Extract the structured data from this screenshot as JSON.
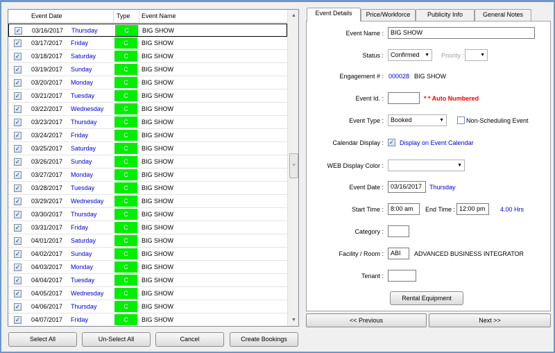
{
  "grid": {
    "headers": {
      "event_date": "Event Date",
      "type": "Type",
      "event_name": "Event Name"
    },
    "rows": [
      {
        "date": "03/16/2017",
        "day": "Thursday",
        "type": "C",
        "name": "BIG SHOW",
        "checked": true
      },
      {
        "date": "03/17/2017",
        "day": "Friday",
        "type": "C",
        "name": "BIG SHOW",
        "checked": true
      },
      {
        "date": "03/18/2017",
        "day": "Saturday",
        "type": "C",
        "name": "BIG SHOW",
        "checked": true
      },
      {
        "date": "03/19/2017",
        "day": "Sunday",
        "type": "C",
        "name": "BIG SHOW",
        "checked": true
      },
      {
        "date": "03/20/2017",
        "day": "Monday",
        "type": "C",
        "name": "BIG SHOW",
        "checked": true
      },
      {
        "date": "03/21/2017",
        "day": "Tuesday",
        "type": "C",
        "name": "BIG SHOW",
        "checked": true
      },
      {
        "date": "03/22/2017",
        "day": "Wednesday",
        "type": "C",
        "name": "BIG SHOW",
        "checked": true
      },
      {
        "date": "03/23/2017",
        "day": "Thursday",
        "type": "C",
        "name": "BIG SHOW",
        "checked": true
      },
      {
        "date": "03/24/2017",
        "day": "Friday",
        "type": "C",
        "name": "BIG SHOW",
        "checked": true
      },
      {
        "date": "03/25/2017",
        "day": "Saturday",
        "type": "C",
        "name": "BIG SHOW",
        "checked": true
      },
      {
        "date": "03/26/2017",
        "day": "Sunday",
        "type": "C",
        "name": "BIG SHOW",
        "checked": true
      },
      {
        "date": "03/27/2017",
        "day": "Monday",
        "type": "C",
        "name": "BIG SHOW",
        "checked": true
      },
      {
        "date": "03/28/2017",
        "day": "Tuesday",
        "type": "C",
        "name": "BIG SHOW",
        "checked": true
      },
      {
        "date": "03/29/2017",
        "day": "Wednesday",
        "type": "C",
        "name": "BIG SHOW",
        "checked": true
      },
      {
        "date": "03/30/2017",
        "day": "Thursday",
        "type": "C",
        "name": "BIG SHOW",
        "checked": true
      },
      {
        "date": "03/31/2017",
        "day": "Friday",
        "type": "C",
        "name": "BIG SHOW",
        "checked": true
      },
      {
        "date": "04/01/2017",
        "day": "Saturday",
        "type": "C",
        "name": "BIG SHOW",
        "checked": true
      },
      {
        "date": "04/02/2017",
        "day": "Sunday",
        "type": "C",
        "name": "BIG SHOW",
        "checked": true
      },
      {
        "date": "04/03/2017",
        "day": "Monday",
        "type": "C",
        "name": "BIG SHOW",
        "checked": true
      },
      {
        "date": "04/04/2017",
        "day": "Tuesday",
        "type": "C",
        "name": "BIG SHOW",
        "checked": true
      },
      {
        "date": "04/05/2017",
        "day": "Wednesday",
        "type": "C",
        "name": "BIG SHOW",
        "checked": true
      },
      {
        "date": "04/06/2017",
        "day": "Thursday",
        "type": "C",
        "name": "BIG SHOW",
        "checked": true
      },
      {
        "date": "04/07/2017",
        "day": "Friday",
        "type": "C",
        "name": "BIG SHOW",
        "checked": true
      }
    ]
  },
  "buttons": {
    "select_all": "Select All",
    "unselect_all": "Un-Select All",
    "cancel": "Cancel",
    "create_bookings": "Create Bookings"
  },
  "tabs": [
    "Event Details",
    "Price/Workforce",
    "Publicity Info",
    "General Notes"
  ],
  "details": {
    "event_name_label": "Event Name :",
    "event_name_value": "BIG SHOW",
    "status_label": "Status :",
    "status_value": "Confirmed",
    "priority_label": "Priority :",
    "priority_value": "",
    "engagement_label": "Engagement # :",
    "engagement_number": "000028",
    "engagement_name": "BIG SHOW",
    "event_id_label": "Event Id. :",
    "event_id_value": "",
    "auto_numbered": "* * Auto Numbered",
    "event_type_label": "Event Type :",
    "event_type_value": "Booked",
    "non_scheduling_label": "Non-Scheduling Event",
    "calendar_display_label": "Calendar Display :",
    "calendar_display_text": "Display on Event Calendar",
    "web_color_label": "WEB Display Color :",
    "web_color_value": "",
    "event_date_label": "Event Date :",
    "event_date_value": "03/16/2017",
    "event_day": "Thursday",
    "start_time_label": "Start Time :",
    "start_time_value": "8:00 am",
    "end_time_label": "End Time :",
    "end_time_value": "12:00 pm",
    "hours": "4.00 Hrs",
    "category_label": "Category :",
    "category_value": "",
    "facility_label": "Facility / Room :",
    "facility_code": "ABI",
    "facility_name": "ADVANCED BUSINESS INTEGRATOR",
    "tenant_label": "Tenant :",
    "tenant_value": "",
    "rental_equipment": "Rental Equipment"
  },
  "nav": {
    "previous": "<< Previous",
    "next": "Next >>"
  },
  "colors": {
    "type_badge": "#00ee00",
    "accent_blue": "#0000cc",
    "alert_red": "#ff0000"
  },
  "icons": {
    "checkbox": "check-icon",
    "dropdown": "chevron-down-icon",
    "scroll_up": "arrow-up-icon",
    "scroll_down": "arrow-down-icon"
  }
}
